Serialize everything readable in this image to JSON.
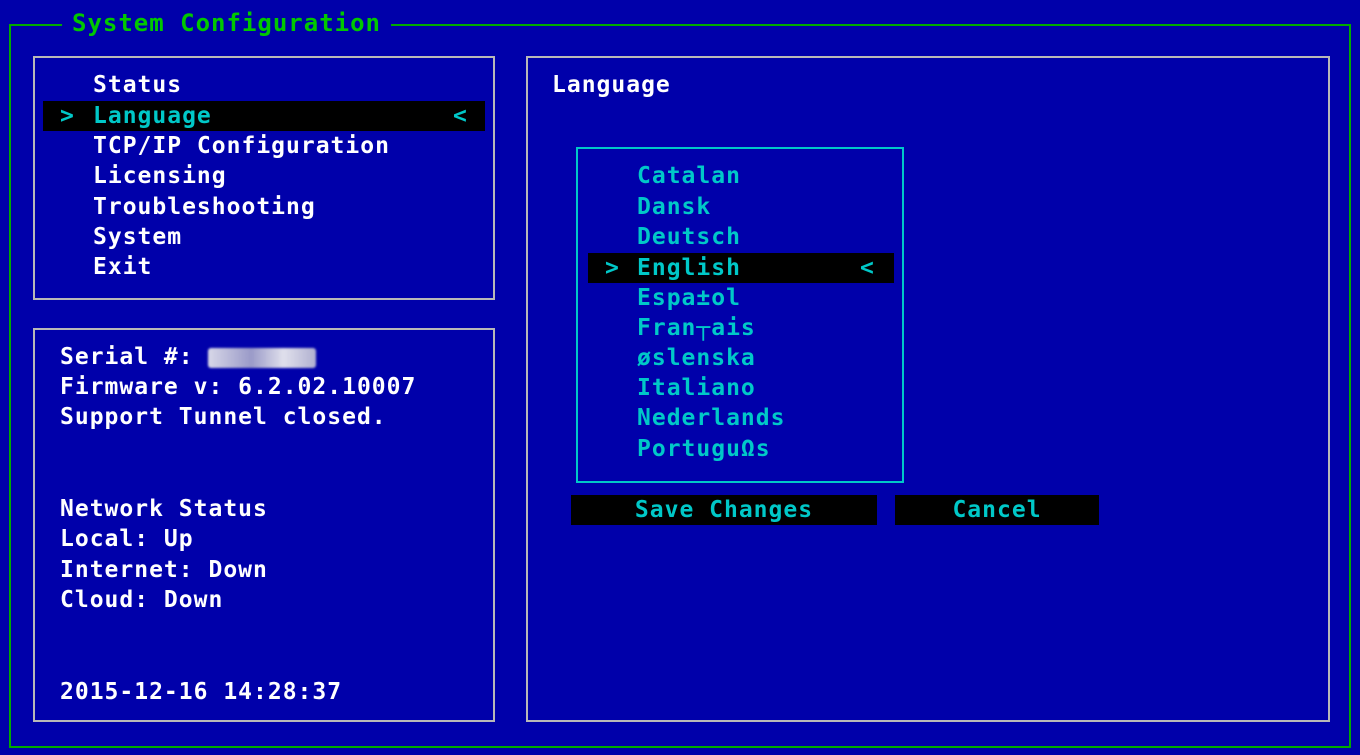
{
  "window": {
    "title": "System Configuration"
  },
  "menu": {
    "selected_marker_left": ">",
    "selected_marker_right": "<",
    "items": [
      {
        "label": "Status"
      },
      {
        "label": "Language"
      },
      {
        "label": "TCP/IP Configuration"
      },
      {
        "label": "Licensing"
      },
      {
        "label": "Troubleshooting"
      },
      {
        "label": "System"
      },
      {
        "label": "Exit"
      }
    ],
    "selected_index": 1
  },
  "info": {
    "serial_label": "Serial #: ",
    "firmware": "Firmware v: 6.2.02.10007",
    "support_tunnel": "Support Tunnel closed.",
    "network_status_heading": "Network Status",
    "local": "Local: Up",
    "internet": "Internet: Down",
    "cloud": "Cloud: Down",
    "datetime": "2015-12-16 14:28:37"
  },
  "main": {
    "title": "Language",
    "languages": [
      {
        "label": "Catalan"
      },
      {
        "label": "Dansk"
      },
      {
        "label": "Deutsch"
      },
      {
        "label": "English"
      },
      {
        "label": "Espa±ol"
      },
      {
        "label": "Fran┬ais"
      },
      {
        "label": "øslenska"
      },
      {
        "label": "Italiano"
      },
      {
        "label": "Nederlands"
      },
      {
        "label": "PortuguΩs"
      }
    ],
    "selected_index": 3,
    "save_button": "Save Changes",
    "cancel_button": "Cancel"
  },
  "colors": {
    "background": "#0000aa",
    "frame": "#00aa00",
    "title": "#00c800",
    "panel_border": "#b8b8b8",
    "accent": "#00c8c8",
    "text": "#ffffff",
    "highlight_bg": "#000000"
  }
}
